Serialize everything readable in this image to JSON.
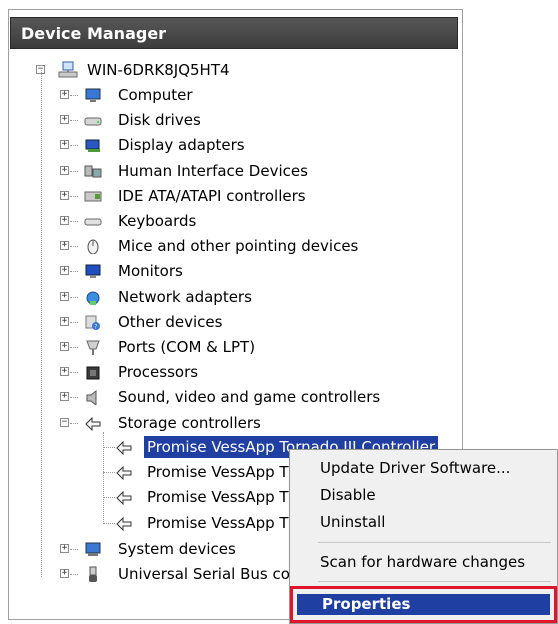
{
  "window": {
    "title": "Device Manager"
  },
  "tree": {
    "root": "WIN-6DRK8JQ5HT4",
    "categories": [
      {
        "label": "Computer",
        "icon": "computer-icon"
      },
      {
        "label": "Disk drives",
        "icon": "disk-drive-icon"
      },
      {
        "label": "Display adapters",
        "icon": "display-adapter-icon"
      },
      {
        "label": "Human Interface Devices",
        "icon": "hid-icon"
      },
      {
        "label": "IDE ATA/ATAPI controllers",
        "icon": "ide-controller-icon"
      },
      {
        "label": "Keyboards",
        "icon": "keyboard-icon"
      },
      {
        "label": "Mice and other pointing devices",
        "icon": "mouse-icon"
      },
      {
        "label": "Monitors",
        "icon": "monitor-icon"
      },
      {
        "label": "Network adapters",
        "icon": "network-adapter-icon"
      },
      {
        "label": "Other devices",
        "icon": "other-devices-icon"
      },
      {
        "label": "Ports (COM & LPT)",
        "icon": "ports-icon"
      },
      {
        "label": "Processors",
        "icon": "processor-icon"
      },
      {
        "label": "Sound, video and game controllers",
        "icon": "sound-icon"
      },
      {
        "label": "Storage controllers",
        "icon": "storage-controller-icon"
      }
    ],
    "storage_children": [
      "Promise VessApp Tornado III Controller",
      "Promise VessApp T",
      "Promise VessApp T",
      "Promise VessApp T"
    ],
    "after": [
      {
        "label": "System devices",
        "icon": "system-devices-icon"
      },
      {
        "label": "Universal Serial Bus co",
        "icon": "usb-icon"
      }
    ]
  },
  "context_menu": {
    "items": [
      "Update Driver Software...",
      "Disable",
      "Uninstall"
    ],
    "scan": "Scan for hardware changes",
    "properties": "Properties"
  },
  "colors": {
    "selection": "#1f3fa3",
    "highlight_box": "#e0152b",
    "title_bar": "#474747"
  }
}
